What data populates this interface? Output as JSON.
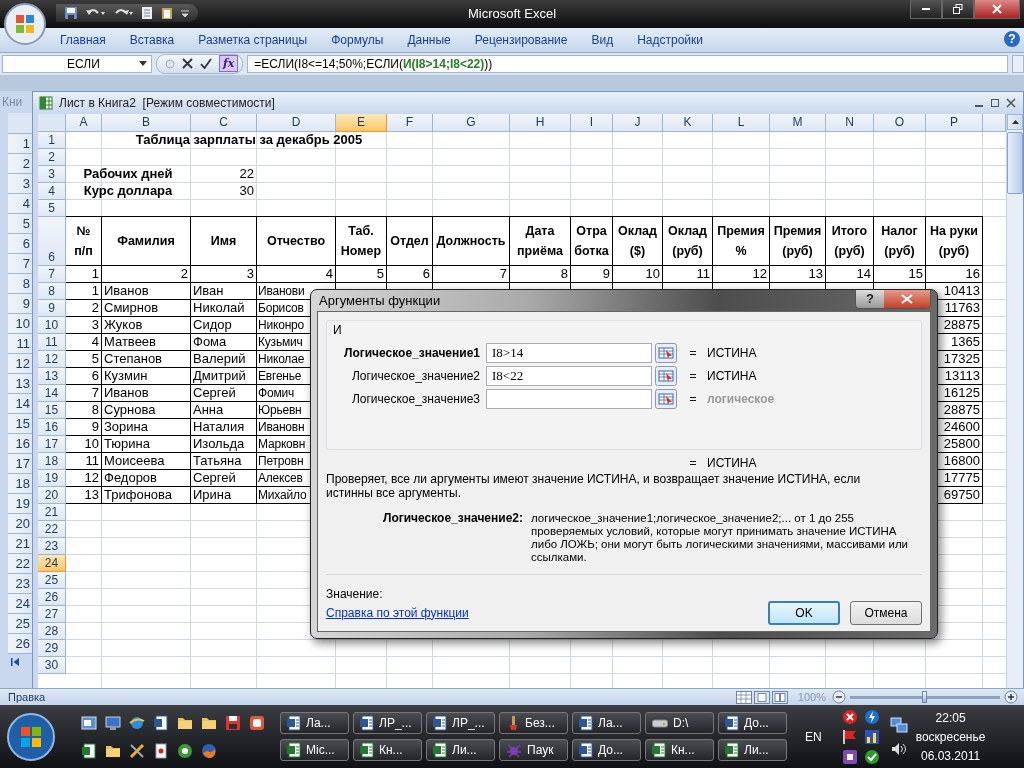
{
  "app": {
    "title": "Microsoft Excel"
  },
  "ribbon": {
    "tabs": [
      "Главная",
      "Вставка",
      "Разметка страницы",
      "Формулы",
      "Данные",
      "Рецензирование",
      "Вид",
      "Надстройки"
    ],
    "help": "?"
  },
  "formula_bar": {
    "name_box": "ЕСЛИ",
    "fx": "fx",
    "formula": "=ЕСЛИ(I8<=14;50%;ЕСЛИ(**И(I8>14;I8<22)**))"
  },
  "back_window": {
    "title": "Кни",
    "row_numbers": [
      "1",
      "2",
      "3",
      "4",
      "5",
      "6",
      "7",
      "8",
      "9",
      "10",
      "11",
      "12",
      "13",
      "14",
      "15",
      "16",
      "17",
      "18",
      "19",
      "20",
      "21",
      "22",
      "23",
      "24",
      "25",
      "26"
    ]
  },
  "workbook": {
    "title": "Лист в Книга2  [Режим совместимости]",
    "columns": [
      {
        "label": "A",
        "selected": false
      },
      {
        "label": "B",
        "selected": false
      },
      {
        "label": "C",
        "selected": false
      },
      {
        "label": "D",
        "selected": false
      },
      {
        "label": "E",
        "selected": true
      },
      {
        "label": "F",
        "selected": false
      },
      {
        "label": "G",
        "selected": false
      },
      {
        "label": "H",
        "selected": false
      },
      {
        "label": "I",
        "selected": false
      },
      {
        "label": "J",
        "selected": false
      },
      {
        "label": "K",
        "selected": false
      },
      {
        "label": "L",
        "selected": false
      },
      {
        "label": "M",
        "selected": false
      },
      {
        "label": "N",
        "selected": false
      },
      {
        "label": "O",
        "selected": false
      },
      {
        "label": "P",
        "selected": false
      }
    ],
    "rows": [
      {
        "number": "1",
        "selected": false,
        "kind": "title",
        "cells": {
          "A": "Таблица зарплаты за декабрь 2005"
        }
      },
      {
        "number": "2",
        "selected": false,
        "kind": "empty"
      },
      {
        "number": "3",
        "selected": false,
        "kind": "param",
        "cells": {
          "A": "Рабочих дней",
          "C": "22"
        }
      },
      {
        "number": "4",
        "selected": false,
        "kind": "param",
        "cells": {
          "A": "Курс доллара",
          "C": "30"
        }
      },
      {
        "number": "5",
        "selected": false,
        "kind": "empty"
      },
      {
        "number": "6",
        "selected": false,
        "kind": "header",
        "cells": {
          "A": "№\nп/п",
          "B": "Фамилия",
          "C": "Имя",
          "D": "Отчество",
          "E": "Таб.\nНомер",
          "F": "Отдел",
          "G": "Должность",
          "H": "Дата\nприёма",
          "I": "Отра\nботка",
          "J": "Оклад\n($)",
          "K": "Оклад\n(руб)",
          "L": "Премия\n%",
          "M": "Премия\n(руб)",
          "N": "Итого\n(руб)",
          "O": "Налог\n(руб)",
          "P": "На руки\n(руб)"
        }
      },
      {
        "number": "7",
        "selected": false,
        "kind": "index",
        "cells": {
          "A": "1",
          "B": "2",
          "C": "3",
          "D": "4",
          "E": "5",
          "F": "6",
          "G": "7",
          "H": "8",
          "I": "9",
          "J": "10",
          "K": "11",
          "L": "12",
          "M": "13",
          "N": "14",
          "O": "15",
          "P": "16"
        }
      },
      {
        "number": "8",
        "selected": false,
        "kind": "data",
        "cells": {
          "A": "1",
          "B": "Иванов",
          "C": "Иван",
          "D": "Иванови",
          "P": "10413"
        }
      },
      {
        "number": "9",
        "selected": false,
        "kind": "data",
        "cells": {
          "A": "2",
          "B": "Смирнов",
          "C": "Николай",
          "D": "Борисов",
          "P": "11763"
        }
      },
      {
        "number": "10",
        "selected": false,
        "kind": "data",
        "cells": {
          "A": "3",
          "B": "Жуков",
          "C": "Сидор",
          "D": "Никонро",
          "P": "28875"
        }
      },
      {
        "number": "11",
        "selected": false,
        "kind": "data",
        "cells": {
          "A": "4",
          "B": "Матвеев",
          "C": "Фома",
          "D": "Кузьмич",
          "P": "1365"
        }
      },
      {
        "number": "12",
        "selected": false,
        "kind": "data",
        "cells": {
          "A": "5",
          "B": "Степанов",
          "C": "Валерий",
          "D": "Николае",
          "P": "17325"
        }
      },
      {
        "number": "13",
        "selected": false,
        "kind": "data",
        "cells": {
          "A": "6",
          "B": "Кузмин",
          "C": "Дмитрий",
          "D": "Евгенье",
          "P": "13113"
        }
      },
      {
        "number": "14",
        "selected": false,
        "kind": "data",
        "cells": {
          "A": "7",
          "B": "Иванов",
          "C": "Сергей",
          "D": "Фомич",
          "P": "16125"
        }
      },
      {
        "number": "15",
        "selected": false,
        "kind": "data",
        "cells": {
          "A": "8",
          "B": "Сурнова",
          "C": "Анна",
          "D": "Юрьевн",
          "P": "28875"
        }
      },
      {
        "number": "16",
        "selected": false,
        "kind": "data",
        "cells": {
          "A": "9",
          "B": "Зорина",
          "C": "Наталия",
          "D": "Ивановн",
          "P": "24600"
        }
      },
      {
        "number": "17",
        "selected": false,
        "kind": "data",
        "cells": {
          "A": "10",
          "B": "Тюрина",
          "C": "Изольда",
          "D": "Марковн",
          "P": "25800"
        }
      },
      {
        "number": "18",
        "selected": false,
        "kind": "data",
        "cells": {
          "A": "11",
          "B": "Моисеева",
          "C": "Татьяна",
          "D": "Петровн",
          "P": "16800"
        }
      },
      {
        "number": "19",
        "selected": false,
        "kind": "data",
        "cells": {
          "A": "12",
          "B": "Федоров",
          "C": "Сергей",
          "D": "Алексев",
          "P": "17775"
        }
      },
      {
        "number": "20",
        "selected": false,
        "kind": "data",
        "cells": {
          "A": "13",
          "B": "Трифонова",
          "C": "Ирина",
          "D": "Михайло",
          "P": "69750"
        }
      },
      {
        "number": "21",
        "selected": false,
        "kind": "empty"
      },
      {
        "number": "22",
        "selected": false,
        "kind": "empty"
      },
      {
        "number": "23",
        "selected": false,
        "kind": "empty"
      },
      {
        "number": "24",
        "selected": true,
        "kind": "empty"
      },
      {
        "number": "25",
        "selected": false,
        "kind": "empty"
      },
      {
        "number": "26",
        "selected": false,
        "kind": "empty"
      },
      {
        "number": "27",
        "selected": false,
        "kind": "empty"
      },
      {
        "number": "28",
        "selected": false,
        "kind": "empty"
      },
      {
        "number": "29",
        "selected": false,
        "kind": "empty"
      },
      {
        "number": "30",
        "selected": false,
        "kind": "empty"
      }
    ]
  },
  "dialog": {
    "title": "Аргументы функции",
    "help": "?",
    "function": "И",
    "arguments": [
      {
        "label": "Логическое_значение1",
        "required": true,
        "kind": "filled",
        "value": "I8>14",
        "equals": "=",
        "result": "ИСТИНА"
      },
      {
        "label": "Логическое_значение2",
        "required": false,
        "kind": "filled",
        "value": "I8<22",
        "equals": "=",
        "result": "ИСТИНА"
      },
      {
        "label": "Логическое_значение3",
        "required": false,
        "kind": "empty",
        "equals": "=",
        "result": "логическое"
      }
    ],
    "total": {
      "equals": "=",
      "value": "ИСТИНА"
    },
    "description": "Проверяет, все ли аргументы имеют значение ИСТИНА, и возвращает значение ИСТИНА, если истинны все аргументы.",
    "argument_help": {
      "label": "Логическое_значение2:",
      "text": "логическое_значение1;логическое_значение2;... от 1 до 255 проверяемых условий, которые могут принимать значение ИСТИНА либо ЛОЖЬ; они могут быть логическими значениями, массивами или ссылками."
    },
    "value_label": "Значение:",
    "help_link": "Справка по этой функции",
    "buttons": [
      {
        "label": "OK",
        "default": true
      },
      {
        "label": "Отмена",
        "default": false
      }
    ]
  },
  "status_bar": {
    "mode": "Правка",
    "zoom": "100%",
    "zoom_slider": {
      "level": 0.5
    }
  },
  "taskbar": {
    "tasks": [
      {
        "label": "Ла...",
        "kind": "word"
      },
      {
        "label": "ЛР_...",
        "kind": "word"
      },
      {
        "label": "ЛР_...",
        "kind": "word"
      },
      {
        "label": "Без...",
        "kind": "paint"
      },
      {
        "label": "Ла...",
        "kind": "word"
      },
      {
        "label": "D:\\",
        "kind": "drive"
      },
      {
        "label": "До...",
        "kind": "word"
      },
      {
        "label": "Mic...",
        "kind": "excel"
      },
      {
        "label": "Кн...",
        "kind": "excel"
      },
      {
        "label": "Ли...",
        "kind": "excel"
      },
      {
        "label": "Паук",
        "kind": "spider"
      },
      {
        "label": "До...",
        "kind": "word"
      },
      {
        "label": "Кн...",
        "kind": "excel"
      },
      {
        "label": "Ли...",
        "kind": "excel"
      }
    ],
    "language": "EN",
    "time": "22:05",
    "day": "воскресенье",
    "date": "06.03.2011"
  }
}
